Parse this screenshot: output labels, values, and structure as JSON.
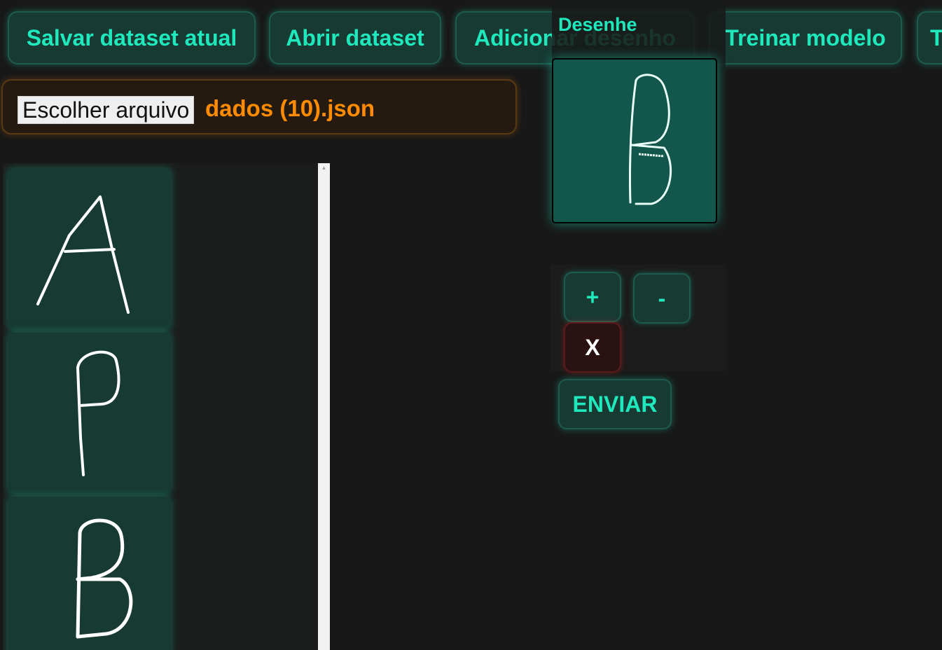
{
  "toolbar": {
    "save_dataset": "Salvar dataset atual",
    "open_dataset": "Abrir dataset",
    "add_drawing": "Adicionar desenho",
    "train_model": "Treinar modelo",
    "next_partial": "T"
  },
  "file_input": {
    "button_label": "Escolher arquivo",
    "file_name": "dados (10).json"
  },
  "dataset": {
    "samples": [
      "A",
      "P",
      "B"
    ]
  },
  "draw_panel": {
    "title": "Desenhe",
    "current_drawing": "B"
  },
  "controls": {
    "zoom_in": "+",
    "zoom_out": "-",
    "clear": "X",
    "send": "ENVIAR"
  },
  "colors": {
    "accent": "#1ee8bc",
    "file_name": "#ff8c00",
    "background": "#181818",
    "canvas": "#13564b"
  }
}
